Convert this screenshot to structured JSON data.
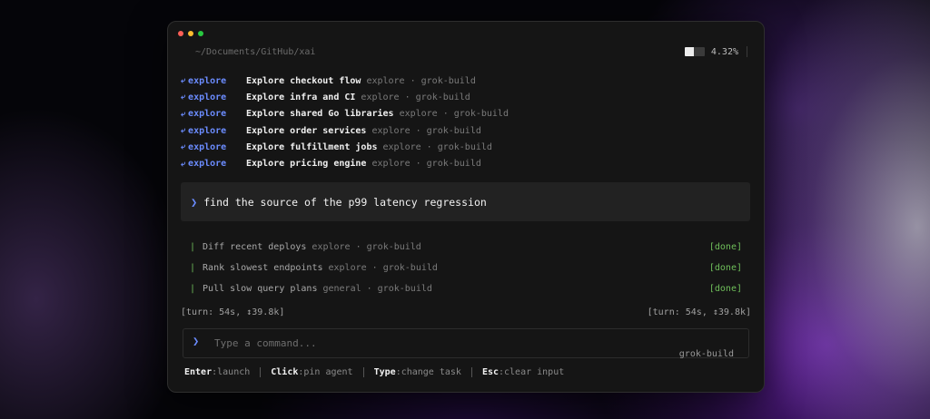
{
  "window": {
    "path": "~/Documents/GitHub/xai",
    "usage": {
      "fraction": 0.45,
      "label": "4.32%"
    }
  },
  "agents": [
    {
      "tag": "explore",
      "title": "Explore checkout flow",
      "meta": "explore · grok-build"
    },
    {
      "tag": "explore",
      "title": "Explore infra and CI",
      "meta": "explore · grok-build"
    },
    {
      "tag": "explore",
      "title": "Explore shared Go libraries",
      "meta": "explore · grok-build"
    },
    {
      "tag": "explore",
      "title": "Explore order services",
      "meta": "explore · grok-build"
    },
    {
      "tag": "explore",
      "title": "Explore fulfillment jobs",
      "meta": "explore · grok-build"
    },
    {
      "tag": "explore",
      "title": "Explore pricing engine",
      "meta": "explore · grok-build"
    }
  ],
  "prompt": {
    "text": "find the source of the p99 latency regression"
  },
  "tasks": [
    {
      "title": "Diff recent deploys",
      "meta": "explore · grok-build",
      "status": "[done]"
    },
    {
      "title": "Rank slowest endpoints",
      "meta": "explore · grok-build",
      "status": "[done]"
    },
    {
      "title": "Pull slow query plans",
      "meta": "general · grok-build",
      "status": "[done]"
    }
  ],
  "turn": {
    "left": "[turn: 54s, ↕39.8k]",
    "right": "[turn: 54s, ↕39.8k]"
  },
  "input": {
    "placeholder": "Type a command...",
    "value": "",
    "agent": "grok-build"
  },
  "hints": [
    {
      "key": "Enter",
      "desc": ":launch"
    },
    {
      "key": "Click",
      "desc": ":pin agent"
    },
    {
      "key": "Type",
      "desc": ":change task"
    },
    {
      "key": "Esc",
      "desc": ":clear input"
    }
  ],
  "colors": {
    "accent": "#6b8cff",
    "done": "#6fbf5a",
    "close": "#fe5f57",
    "minimize": "#febc2e",
    "maximize": "#28c840"
  }
}
